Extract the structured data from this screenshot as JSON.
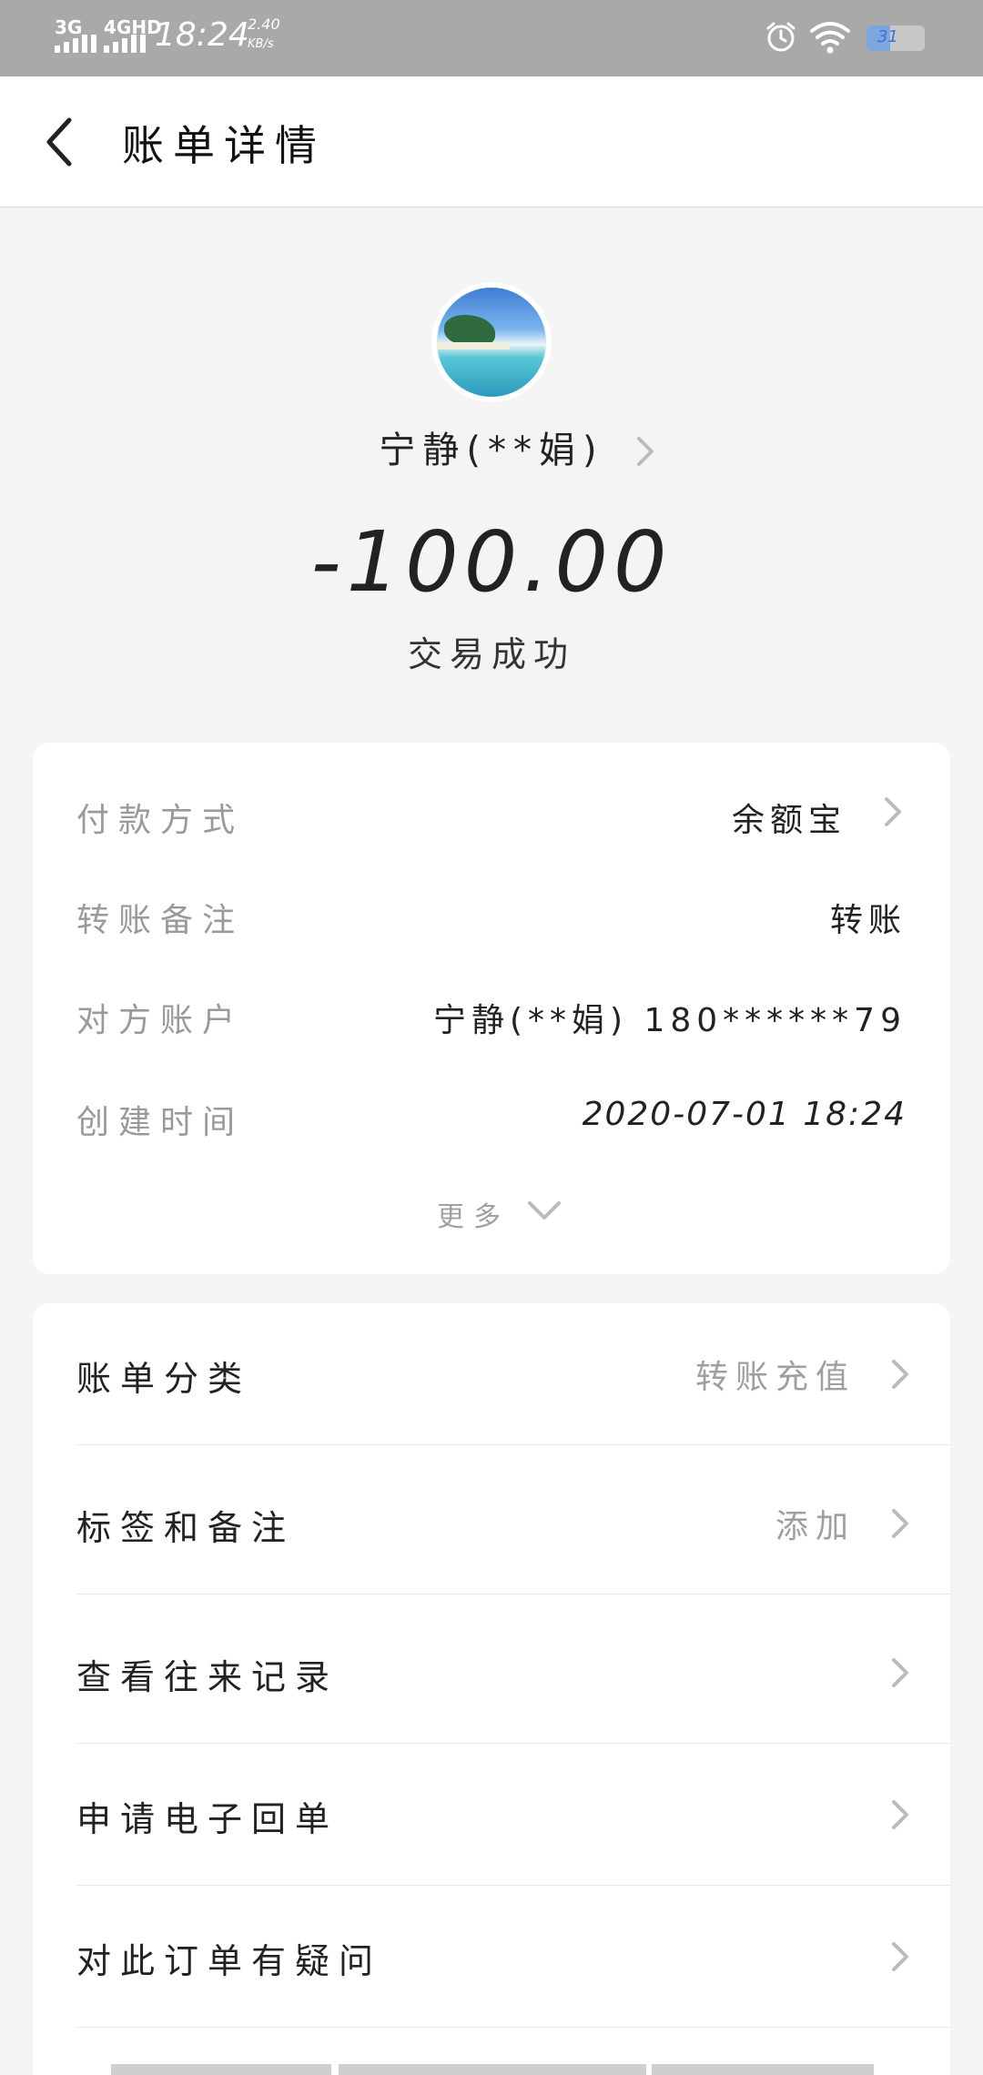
{
  "status_bar": {
    "network_1": "3G",
    "network_2": "4GHD",
    "time": "18:24",
    "speed_value": "2.40",
    "speed_unit": "KB/s",
    "battery_level": "31",
    "icons": [
      "signal-icon",
      "alarm-icon",
      "wifi-icon",
      "battery-icon"
    ]
  },
  "header": {
    "title": "账单详情",
    "back_icon": "chevron-left-icon"
  },
  "profile": {
    "name": "宁静(**娟)",
    "amount": "-100.00",
    "status": "交易成功"
  },
  "details": {
    "rows": [
      {
        "label": "付款方式",
        "value": "余额宝"
      },
      {
        "label": "转账备注",
        "value": "转账"
      },
      {
        "label": "对方账户",
        "value": "宁静(**娟) 180******79"
      },
      {
        "label": "创建时间",
        "value": "2020-07-01 18:24"
      }
    ],
    "more_label": "更多"
  },
  "menu": {
    "items": [
      {
        "label": "账单分类",
        "value": "转账充值"
      },
      {
        "label": "标签和备注",
        "value": "添加"
      },
      {
        "label": "查看往来记录",
        "value": ""
      },
      {
        "label": "申请电子回单",
        "value": ""
      },
      {
        "label": "对此订单有疑问",
        "value": ""
      }
    ]
  },
  "colors": {
    "status_bar_bg": "#a9a9a9",
    "page_bg": "#f4f4f4",
    "card_bg": "#ffffff",
    "label_gray": "#9a9a9a",
    "text_dark": "#222222"
  }
}
